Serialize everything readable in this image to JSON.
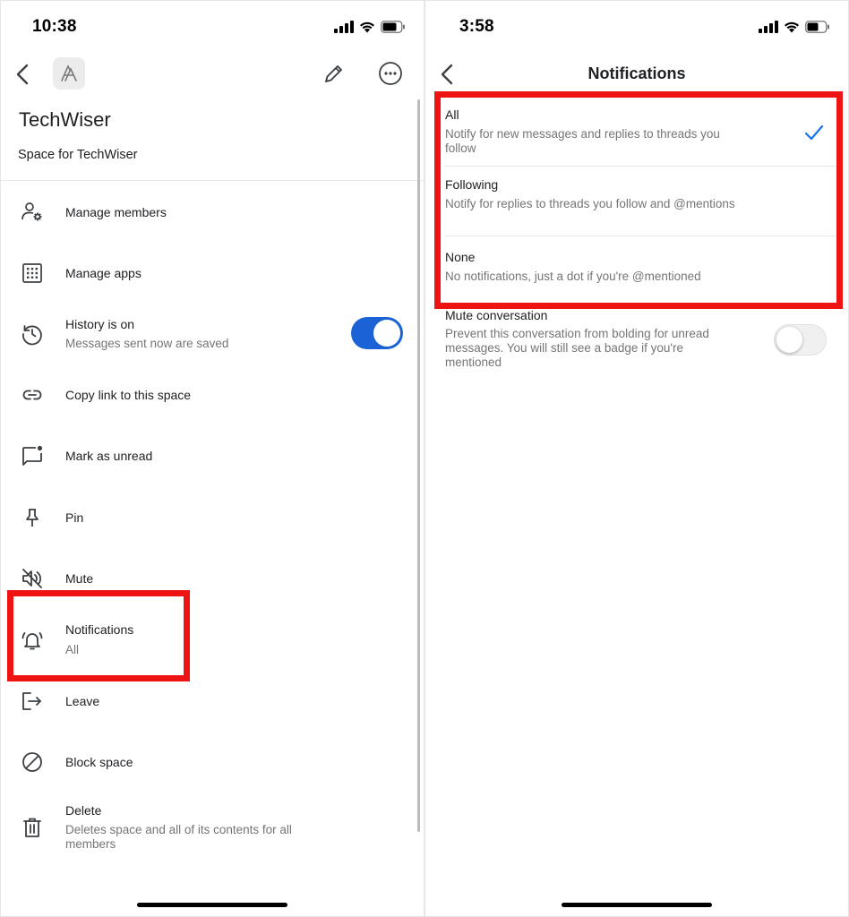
{
  "left_screen": {
    "status_time": "10:38",
    "space_name": "TechWiser",
    "space_description": "Space for TechWiser",
    "menu": [
      {
        "label": "Manage members"
      },
      {
        "label": "Manage apps"
      },
      {
        "label": "History is on",
        "sublabel": "Messages sent now are saved",
        "toggle_on": true
      },
      {
        "label": "Copy link to this space"
      },
      {
        "label": "Mark as unread"
      },
      {
        "label": "Pin"
      },
      {
        "label": "Mute"
      },
      {
        "label": "Notifications",
        "sublabel": "All"
      },
      {
        "label": "Leave"
      },
      {
        "label": "Block space"
      },
      {
        "label": "Delete",
        "sublabel": "Deletes space and all of its contents for all members"
      }
    ]
  },
  "right_screen": {
    "status_time": "3:58",
    "title": "Notifications",
    "options": [
      {
        "label": "All",
        "description": "Notify for new messages and replies to threads you follow",
        "selected": true
      },
      {
        "label": "Following",
        "description": "Notify for replies to threads you follow and @mentions",
        "selected": false
      },
      {
        "label": "None",
        "description": "No notifications, just a dot if you're @mentioned",
        "selected": false
      }
    ],
    "mute": {
      "label": "Mute conversation",
      "description": "Prevent this conversation from bolding for unread messages. You will still see a badge if you're mentioned",
      "toggle_on": false
    }
  },
  "colors": {
    "highlight": "#ee1414",
    "toggle_on": "#1a62d6",
    "check": "#1a73e8"
  }
}
